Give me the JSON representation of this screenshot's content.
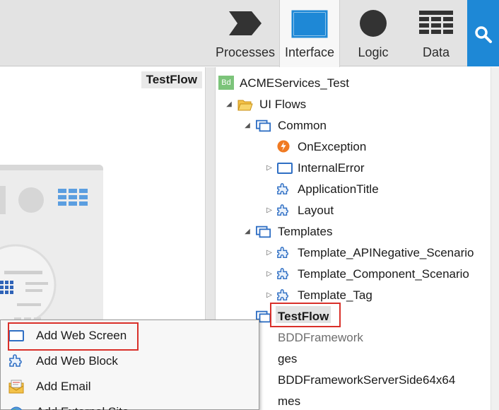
{
  "toolbar": {
    "tabs": [
      {
        "label": "Processes",
        "icon": "processes-icon"
      },
      {
        "label": "Interface",
        "icon": "interface-icon",
        "active": true
      },
      {
        "label": "Logic",
        "icon": "logic-icon"
      },
      {
        "label": "Data",
        "icon": "data-icon"
      }
    ],
    "search_icon": "search-icon"
  },
  "canvas": {
    "title": "TestFlow"
  },
  "tree": {
    "root": {
      "badge": "Bd",
      "label": "ACMEServices_Test"
    },
    "ui_flows": "UI Flows",
    "common": "Common",
    "on_exception": "OnException",
    "internal_error": "InternalError",
    "application_title": "ApplicationTitle",
    "layout": "Layout",
    "templates": "Templates",
    "template_api": "Template_APINegative_Scenario",
    "template_component": "Template_Component_Scenario",
    "template_tag": "Template_Tag",
    "testflow": "TestFlow",
    "bdd_framework": "BDDFramework",
    "images": "ges",
    "bdd_server": "BDDFrameworkServerSide64x64",
    "themes": "mes"
  },
  "menu": {
    "items": [
      {
        "label": "Add Web Screen",
        "icon": "web-screen-icon"
      },
      {
        "label": "Add Web Block",
        "icon": "web-block-icon"
      },
      {
        "label": "Add Email",
        "icon": "email-icon"
      },
      {
        "label": "Add External Site",
        "icon": "external-site-icon"
      }
    ]
  },
  "colors": {
    "accent": "#1e88d6",
    "highlight": "#d9302a",
    "toolbar": "#e3e3e3"
  }
}
